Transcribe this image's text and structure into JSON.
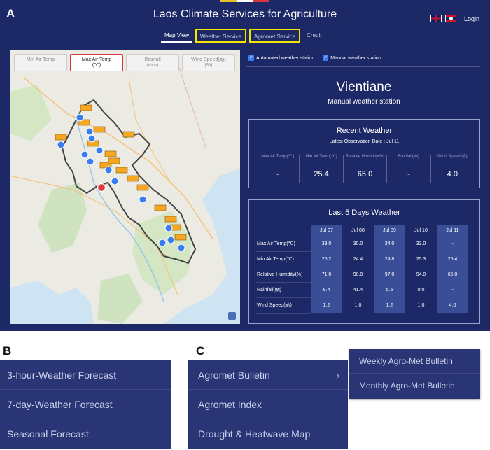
{
  "figure_labels": {
    "a": "A",
    "b": "B",
    "c": "C"
  },
  "colors": {
    "navy": "#1c2966",
    "menu_bg": "#2a3575",
    "highlight_outline": "#f5e600",
    "marker_orange": "#f5a623",
    "station_blue": "#3b7df0",
    "selected_red": "#e03c3c"
  },
  "app": {
    "title": "Laos Climate Services for Agriculture",
    "login": "Login",
    "flags": [
      "uk-flag-icon",
      "lao-flag-icon"
    ]
  },
  "nav": {
    "tabs": [
      "Map View",
      "Weather Service",
      "Agromet Service",
      "Credit"
    ],
    "active": "Map View",
    "outlined": [
      "Weather Service",
      "Agromet Service"
    ]
  },
  "map": {
    "param_tabs": [
      {
        "label": "Min Air Temp",
        "sub": ""
      },
      {
        "label": "Max Air Temp",
        "sub": "(℃)"
      },
      {
        "label": "Rainfall",
        "sub": "(mm)"
      },
      {
        "label": "Wind Speed(㎧)",
        "sub": "(%)"
      }
    ],
    "active_param": "Max Air Temp",
    "info": "i"
  },
  "stations": {
    "automated_label": "Automated weather station",
    "manual_label": "Manual weather station",
    "automated_checked": true,
    "manual_checked": true
  },
  "selected": {
    "name": "Vientiane",
    "type": "Manual weather station"
  },
  "recent": {
    "title": "Recent Weather",
    "latest": "Latest Observation Date : Jul 11",
    "cols": [
      {
        "label": "Max Air Temp(℃)",
        "value": "-"
      },
      {
        "label": "Min Air Temp(℃)",
        "value": "25.4"
      },
      {
        "label": "Relative Humidity(%)",
        "value": "65.0"
      },
      {
        "label": "Rainfall(㎜)",
        "value": "-"
      },
      {
        "label": "Wind Speed(㎧)",
        "value": "4.0"
      }
    ]
  },
  "five_day": {
    "title": "Last 5 Days Weather",
    "days": [
      "Jul 07",
      "Jul 08",
      "Jul 09",
      "Jul 10",
      "Jul 11"
    ],
    "rows": [
      {
        "label": "Max Air Temp(℃)",
        "values": [
          "33.0",
          "30.0",
          "34.0",
          "33.0",
          "-"
        ]
      },
      {
        "label": "Min Air Temp(℃)",
        "values": [
          "26.2",
          "24.4",
          "24.8",
          "25.3",
          "25.4"
        ]
      },
      {
        "label": "Relative Humidity(%)",
        "values": [
          "71.0",
          "90.0",
          "97.0",
          "94.0",
          "65.0"
        ]
      },
      {
        "label": "Rainfall(㎜)",
        "values": [
          "8.4",
          "41.4",
          "5.5",
          "0.0",
          "-"
        ]
      },
      {
        "label": "Wind Speed(㎧)",
        "values": [
          "1.2",
          "1.0",
          "1.2",
          "1.0",
          "4.0"
        ]
      }
    ]
  },
  "weather_menu": [
    "3-hour-Weather Forecast",
    "7-day-Weather Forecast",
    "Seasonal Forecast"
  ],
  "agromet_menu": [
    "Agromet Bulletin",
    "Agromet Index",
    "Drought & Heatwave Map"
  ],
  "agromet_submenu": [
    "Weekly Agro-Met Bulletin",
    "Monthly Agro-Met Bulletin"
  ]
}
